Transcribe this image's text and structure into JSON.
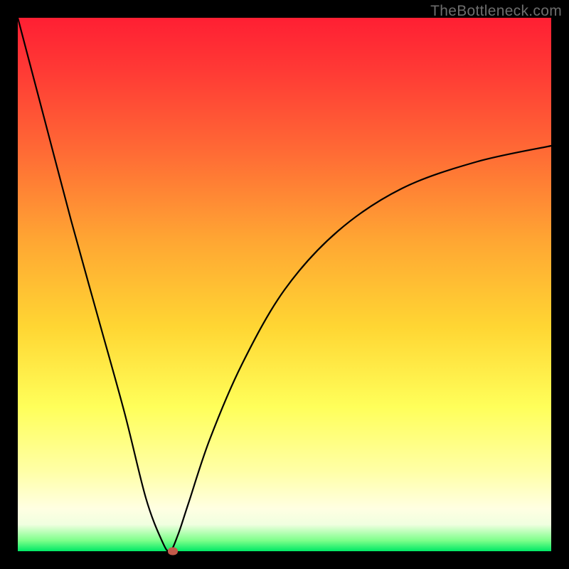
{
  "watermark": "TheBottleneck.com",
  "chart_data": {
    "type": "line",
    "title": "",
    "xlabel": "",
    "ylabel": "",
    "xlim": [
      0,
      100
    ],
    "ylim": [
      0,
      100
    ],
    "grid": false,
    "series": [
      {
        "name": "bottleneck-curve",
        "x": [
          0,
          5,
          10,
          15,
          20,
          24,
          27,
          28.5,
          30,
          32,
          36,
          42,
          50,
          60,
          72,
          86,
          100
        ],
        "values": [
          100,
          81,
          62,
          44,
          26,
          10,
          2,
          0,
          3,
          9,
          21,
          35,
          49,
          60,
          68,
          73,
          76
        ]
      }
    ],
    "marker": {
      "x": 29,
      "y": 0,
      "color": "#c35a4a"
    }
  }
}
